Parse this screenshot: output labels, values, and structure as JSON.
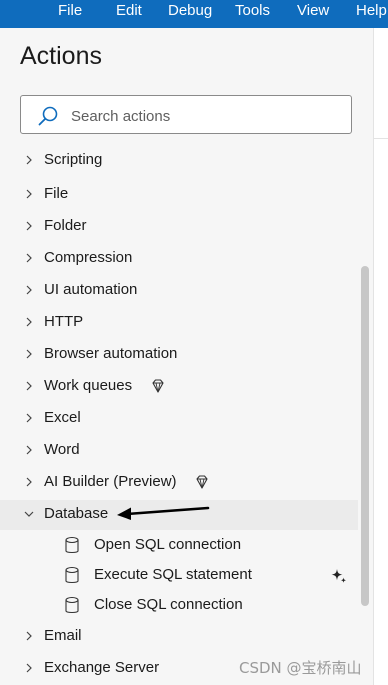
{
  "menu": [
    "File",
    "Edit",
    "Debug",
    "Tools",
    "View",
    "Help"
  ],
  "panel": {
    "title": "Actions",
    "search_placeholder": "Search actions"
  },
  "groups": [
    {
      "label": "Scripting",
      "expanded": false,
      "premium": false
    },
    {
      "label": "File",
      "expanded": false,
      "premium": false
    },
    {
      "label": "Folder",
      "expanded": false,
      "premium": false
    },
    {
      "label": "Compression",
      "expanded": false,
      "premium": false
    },
    {
      "label": "UI automation",
      "expanded": false,
      "premium": false
    },
    {
      "label": "HTTP",
      "expanded": false,
      "premium": false
    },
    {
      "label": "Browser automation",
      "expanded": false,
      "premium": false
    },
    {
      "label": "Work queues",
      "expanded": false,
      "premium": true
    },
    {
      "label": "Excel",
      "expanded": false,
      "premium": false
    },
    {
      "label": "Word",
      "expanded": false,
      "premium": false
    },
    {
      "label": "AI Builder (Preview)",
      "expanded": false,
      "premium": true
    },
    {
      "label": "Database",
      "expanded": true,
      "premium": false
    },
    {
      "label": "Email",
      "expanded": false,
      "premium": false
    },
    {
      "label": "Exchange Server",
      "expanded": false,
      "premium": false
    }
  ],
  "database_actions": [
    {
      "label": "Open SQL connection",
      "icon": "database-icon"
    },
    {
      "label": "Execute SQL statement",
      "icon": "database-icon",
      "sparkle": true
    },
    {
      "label": "Close SQL connection",
      "icon": "database-icon"
    }
  ],
  "watermark": "CSDN @宝桥南山",
  "colors": {
    "menubar": "#0f6cbd",
    "panel": "#f6f6f6",
    "expanded_row": "#ebebeb"
  }
}
